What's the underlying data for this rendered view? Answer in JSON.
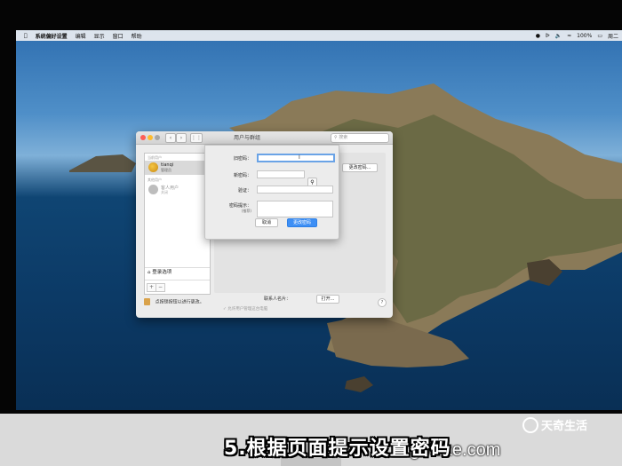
{
  "menubar": {
    "app_name": "系统偏好设置",
    "menus": [
      "编辑",
      "显示",
      "窗口",
      "帮助"
    ],
    "battery": "100%",
    "clock": "周二"
  },
  "window": {
    "title": "用户与群组",
    "search_placeholder": "搜索",
    "sidebar": {
      "current_user_header": "当前用户",
      "current_user": {
        "name": "tianqi",
        "role": "管理员"
      },
      "other_users_header": "其他用户",
      "guest_user": {
        "name": "客人用户",
        "role": "关闭"
      },
      "login_options": "登录选项",
      "add_label": "+",
      "remove_label": "−"
    },
    "main": {
      "change_password_button": "更改密码...",
      "contact_card_label": "联系人名片：",
      "open_button": "打开...",
      "parental_controls": "允许用户管理这台电脑"
    },
    "lock_text": "点按锁按钮以进行更改。",
    "help_label": "?"
  },
  "sheet": {
    "old_password_label": "旧密码：",
    "new_password_label": "新密码：",
    "verify_label": "验证：",
    "hint_label": "密码提示：",
    "hint_sublabel": "(推荐)",
    "cancel_button": "取消",
    "change_button": "更改密码"
  },
  "overlay": {
    "caption": "5.根据页面提示设置密码",
    "watermark_name": "天奇生活",
    "watermark_url": "ngbaike.com"
  }
}
